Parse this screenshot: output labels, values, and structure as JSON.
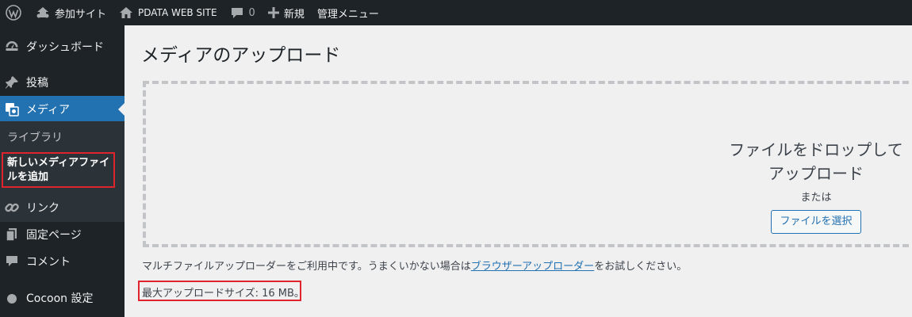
{
  "adminbar": {
    "site_name": "参加サイト",
    "site_title": "PDATA WEB SITE",
    "comments_count": "0",
    "new_label": "新規",
    "manage_menu": "管理メニュー"
  },
  "sidebar": {
    "items": [
      {
        "label": "ダッシュボード",
        "icon": "dashboard-icon"
      },
      {
        "label": "投稿",
        "icon": "pin-icon"
      },
      {
        "label": "メディア",
        "icon": "media-icon"
      },
      {
        "label": "リンク",
        "icon": "link-icon"
      },
      {
        "label": "固定ページ",
        "icon": "page-icon"
      },
      {
        "label": "コメント",
        "icon": "comment-icon"
      },
      {
        "label": "Cocoon 設定",
        "icon": "circle-icon"
      }
    ],
    "submenu": {
      "library": "ライブラリ",
      "add_new": "新しいメディアファイルを追加"
    }
  },
  "main": {
    "title": "メディアのアップロード",
    "drop_text": "ファイルをドロップしてアップロード",
    "or_text": "または",
    "select_button": "ファイルを選択",
    "multi_text_before": "マルチファイルアップローダーをご利用中です。うまくいかない場合は",
    "browser_uploader_link": "ブラウザーアップローダー",
    "multi_text_after": "をお試しください。",
    "max_size": "最大アップロードサイズ: 16 MB。"
  },
  "colors": {
    "adminbar_bg": "#1d2327",
    "accent": "#2271b1",
    "highlight": "#e0242e",
    "content_bg": "#f0f0f1"
  }
}
